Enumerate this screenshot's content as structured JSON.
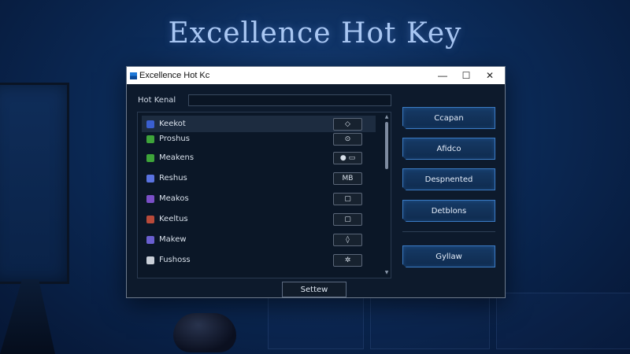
{
  "scene": {
    "headline": "Excellence Hot Key"
  },
  "window": {
    "title": "Excellence Hot Kc",
    "controls": {
      "minimize": "—",
      "maximize": "☐",
      "close": "✕"
    },
    "field_label": "Hot Kenal",
    "field_value": "",
    "list": [
      {
        "label": "Keekot",
        "key": "◇",
        "icon_color": "#3a5fd0",
        "icon": "n-icon",
        "selected": true
      },
      {
        "label": "Proshus",
        "key": "⊙",
        "icon_color": "#3ea43a",
        "icon": "square-icon",
        "selected": false
      },
      {
        "label": "Meakens",
        "key": "● ▭",
        "icon_color": "#3ea43a",
        "icon": "puzzle-icon",
        "selected": false
      },
      {
        "label": "Reshus",
        "key": "MB",
        "icon_color": "#5a72e0",
        "icon": "shield-icon",
        "selected": false
      },
      {
        "label": "Meakos",
        "key": "▢",
        "icon_color": "#7a4fc8",
        "icon": "tile-icon",
        "selected": false
      },
      {
        "label": "Keeltus",
        "key": "▢",
        "icon_color": "#b84a3a",
        "icon": "arrow-icon",
        "selected": false
      },
      {
        "label": "Makew",
        "key": "◊",
        "icon_color": "#6a5fd0",
        "icon": "diamond-icon",
        "selected": false
      },
      {
        "label": "Fushoss",
        "key": "✲",
        "icon_color": "#c9cfd8",
        "icon": "pointer-icon",
        "selected": false
      }
    ],
    "side_buttons": [
      "Ccapan",
      "Afidco",
      "Despnented",
      "Detblons",
      "Gyllaw"
    ],
    "bottom_button": "Settew"
  },
  "colors": {
    "accent": "#3b7bc4",
    "window_bg": "#0d1a2c",
    "background": "#0b2a57"
  }
}
